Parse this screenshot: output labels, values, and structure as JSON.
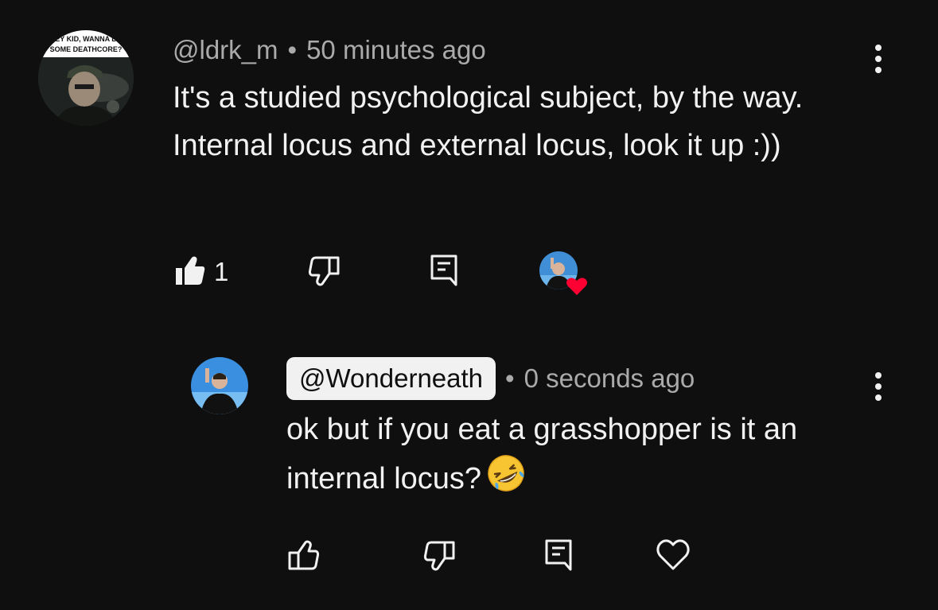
{
  "comment": {
    "author": "@ldrk_m",
    "separator": "•",
    "timestamp": "50 minutes ago",
    "text": "It's a studied psychological subject, by the way. Internal locus and external locus, look it up :))",
    "avatar_caption_line1": "HEY KID, WANNA BU",
    "avatar_caption_line2": "SOME DEATHCORE?",
    "like_count": "1",
    "icons": {
      "like": "thumbs-up-filled-icon",
      "dislike": "thumbs-down-icon",
      "reply": "comment-icon",
      "creator_heart": "creator-heart-icon",
      "more": "more-vert-icon"
    }
  },
  "reply": {
    "author": "@Wonderneath",
    "separator": "•",
    "timestamp": "0 seconds ago",
    "text": "ok but if you eat a grasshopper is it an internal locus?",
    "emoji": "rolling-on-floor-laughing-emoji",
    "icons": {
      "like": "thumbs-up-icon",
      "dislike": "thumbs-down-icon",
      "reply": "comment-icon",
      "heart": "heart-outline-icon",
      "more": "more-vert-icon"
    }
  },
  "colors": {
    "background": "#0f0f0f",
    "primary_text": "#f1f1f1",
    "secondary_text": "#aaaaaa",
    "heart_red": "#ff0033"
  }
}
